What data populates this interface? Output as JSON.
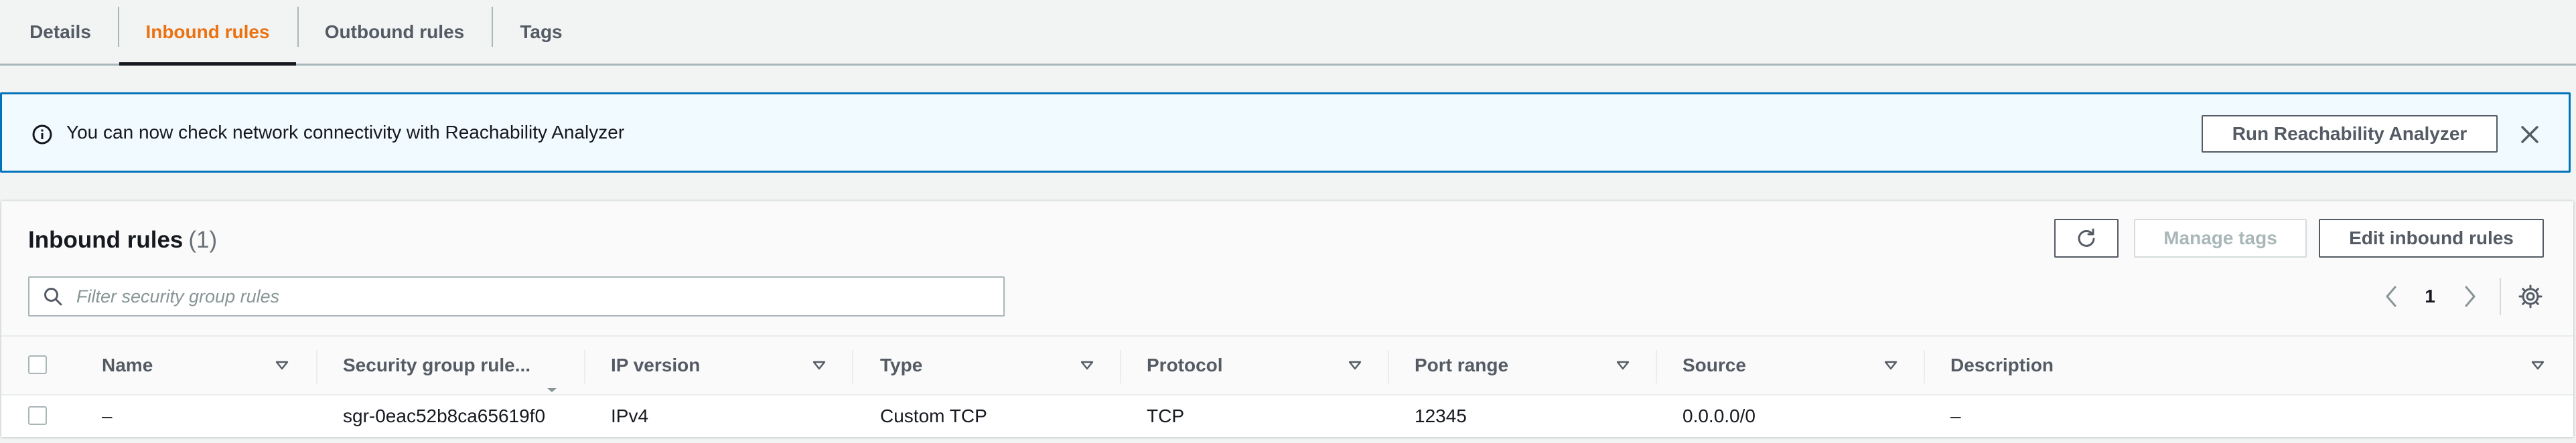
{
  "tabs": [
    {
      "label": "Details",
      "active": false
    },
    {
      "label": "Inbound rules",
      "active": true
    },
    {
      "label": "Outbound rules",
      "active": false
    },
    {
      "label": "Tags",
      "active": false
    }
  ],
  "banner": {
    "text": "You can now check network connectivity with Reachability Analyzer",
    "button_label": "Run Reachability Analyzer",
    "icon": "info-icon",
    "accent_color": "#0073bb",
    "background_color": "#f1faff"
  },
  "panel": {
    "title": "Inbound rules",
    "count": "(1)",
    "manage_tags_label": "Manage tags",
    "edit_label": "Edit inbound rules",
    "filter_placeholder": "Filter security group rules",
    "current_page": "1"
  },
  "table": {
    "columns": [
      "Name",
      "Security group rule...",
      "IP version",
      "Type",
      "Protocol",
      "Port range",
      "Source",
      "Description"
    ],
    "rows": [
      {
        "name": "–",
        "rule_id": "sgr-0eac52b8ca65619f0",
        "ip_version": "IPv4",
        "type": "Custom TCP",
        "protocol": "TCP",
        "port_range": "12345",
        "source": "0.0.0.0/0",
        "description": "–"
      }
    ]
  },
  "colors": {
    "active_tab": "#ec7211",
    "text": "#16191f",
    "muted": "#545b64",
    "disabled": "#aab7b8"
  }
}
